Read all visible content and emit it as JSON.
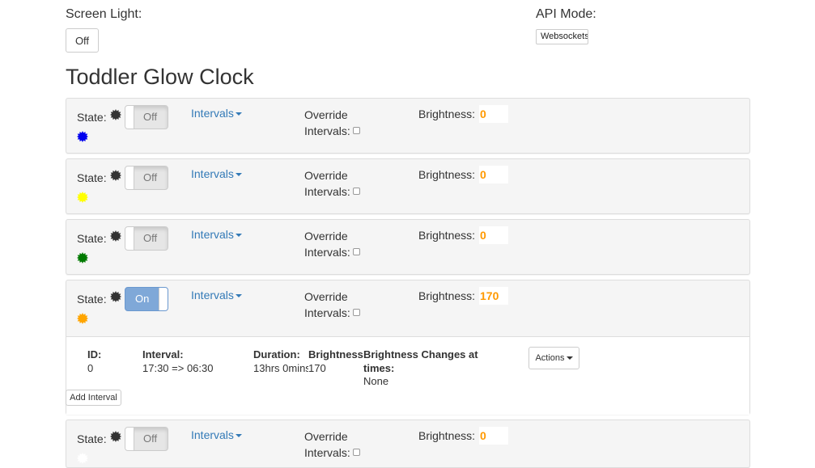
{
  "top": {
    "screen_light_label": "Screen Light:",
    "screen_light_button": "Off",
    "api_mode_label": "API Mode:",
    "api_mode_value": "Websockets"
  },
  "page_title": "Toddler Glow Clock",
  "common": {
    "state_label": "State:",
    "intervals_label": "Intervals",
    "override_line1": "Override",
    "override_line2": "Intervals:",
    "brightness_label": "Brightness:"
  },
  "lights": [
    {
      "color": "#0000ee",
      "state": "Off",
      "brightness": "0"
    },
    {
      "color": "#ffff00",
      "state": "Off",
      "brightness": "0"
    },
    {
      "color": "#007a00",
      "state": "Off",
      "brightness": "0"
    },
    {
      "color": "#ffa500",
      "state": "On",
      "brightness": "170"
    },
    {
      "color": "#ffffff",
      "state": "Off",
      "brightness": "0"
    }
  ],
  "interval_table": {
    "headers": {
      "id": "ID:",
      "interval": "Interval:",
      "duration": "Duration:",
      "brightness": "Brightness:",
      "changes_line1": "Brightness Changes at",
      "changes_line2": "times:"
    },
    "rows": [
      {
        "id": "0",
        "interval": "17:30 => 06:30",
        "duration": "13hrs 0mins",
        "brightness": "170",
        "changes": "None"
      }
    ],
    "actions_label": "Actions",
    "add_interval_label": "Add Interval"
  },
  "icons": {
    "state_icon": "gear-icon",
    "color_icon": "gear-icon"
  }
}
